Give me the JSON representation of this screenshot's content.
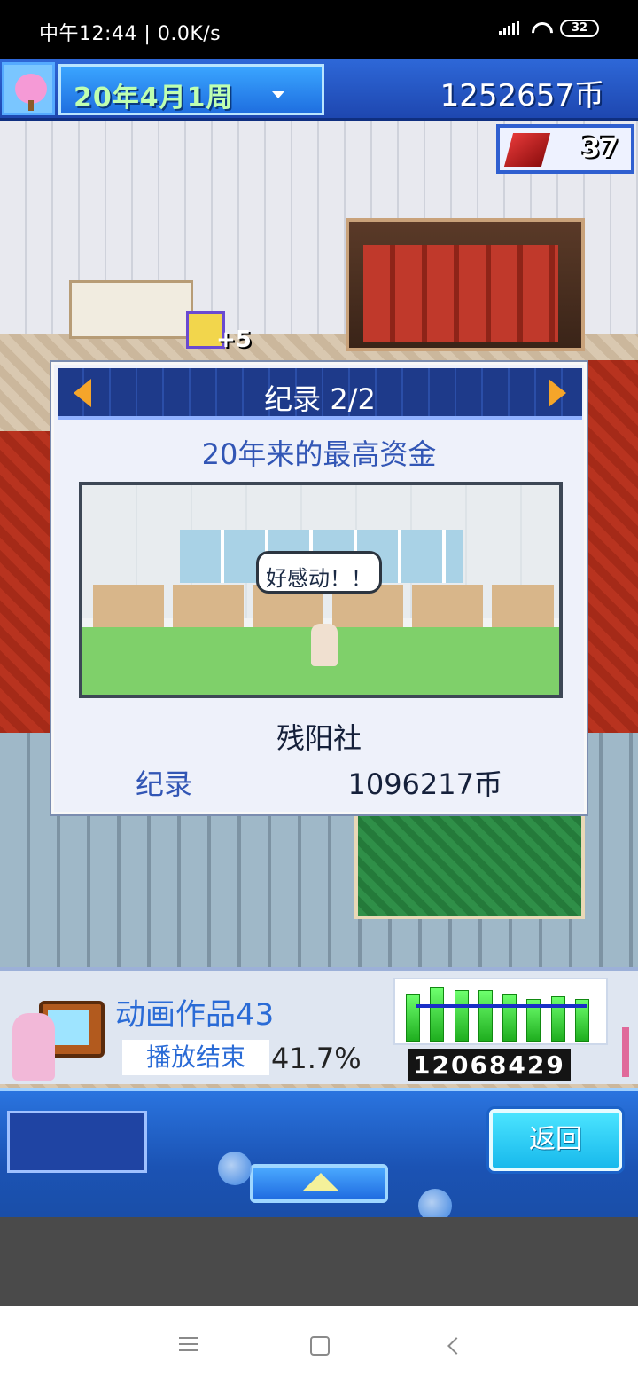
{
  "status_bar": {
    "time": "中午12:44",
    "separator": "|",
    "net_speed": "0.0K/s",
    "battery": "32"
  },
  "top_bar": {
    "date": "20年4月1周",
    "money": "1252657币",
    "badge_count": "37"
  },
  "scene": {
    "plus_label": "+5"
  },
  "dialog": {
    "title": "纪录 2/2",
    "subtitle": "20年来的最高资金",
    "speech_bubble": "好感动！！",
    "company": "残阳社",
    "record_label": "纪录",
    "record_value": "1096217币"
  },
  "info_panel": {
    "work_title": "动画作品43",
    "status_label": "播放结束",
    "percent": "41.7%",
    "viewers": "12068429",
    "chart_data": {
      "type": "bar",
      "values": [
        8,
        9,
        8.5,
        8.5,
        8,
        7,
        7.5,
        7
      ],
      "line_values": [
        6.5,
        6.6,
        6.5,
        6.5,
        6.5,
        6.5,
        6.5,
        6.5
      ],
      "ylim": [
        0,
        10
      ]
    }
  },
  "controls": {
    "back_label": "返回"
  },
  "nav": {
    "menu": "menu-icon",
    "home": "home-icon",
    "back": "back-icon"
  }
}
